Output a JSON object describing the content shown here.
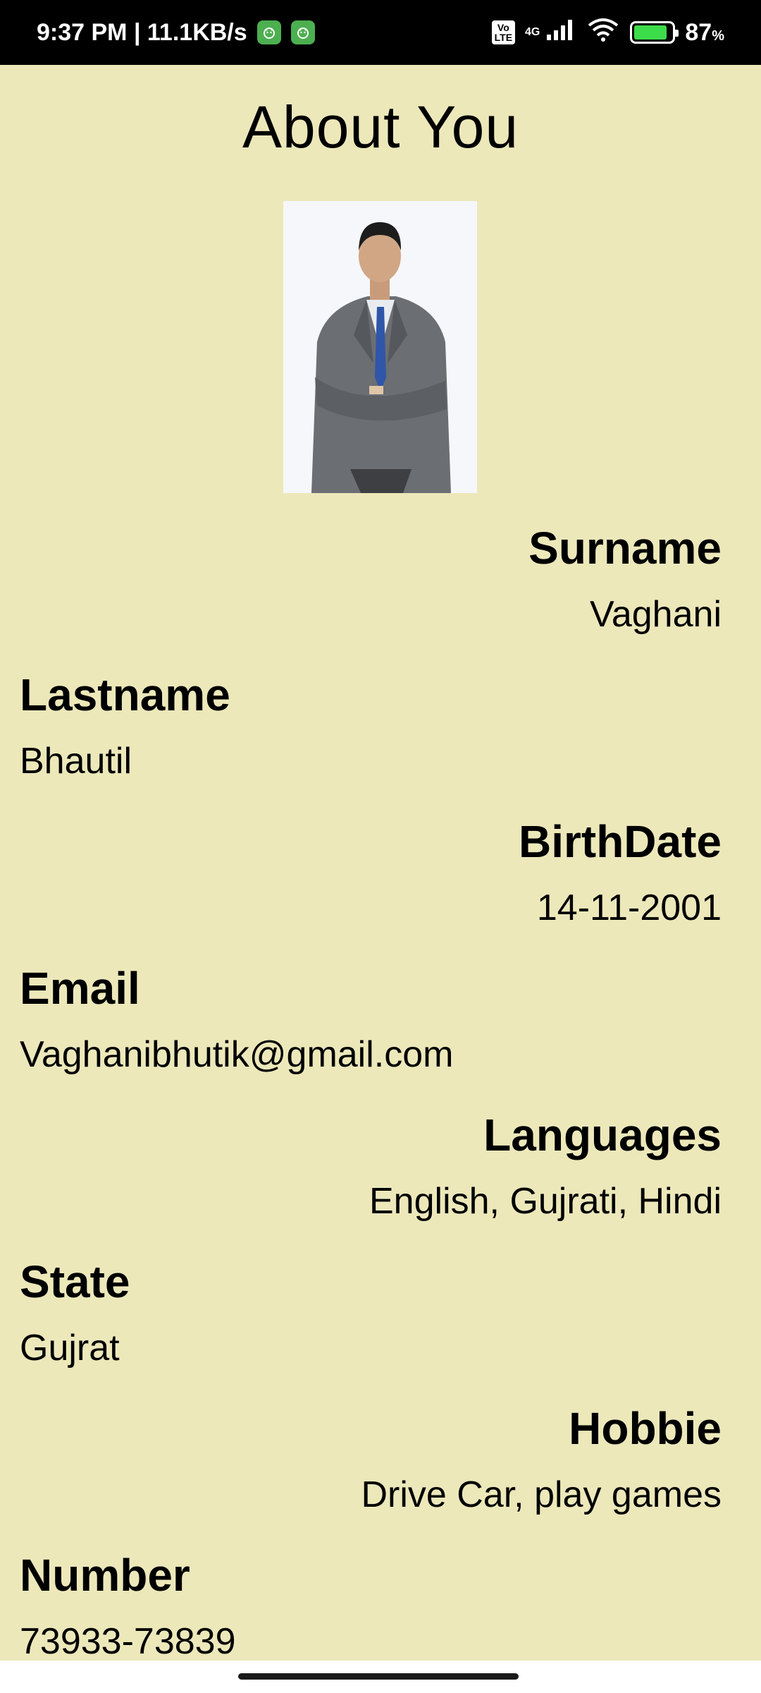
{
  "status_bar": {
    "time_speed": "9:37 PM | 11.1KB/s",
    "network_type": "4G",
    "volte_label_1": "Vo",
    "volte_label_2": "LTE",
    "battery_percent": "87",
    "battery_percent_sign": "%",
    "battery_level": 0.87,
    "battery_color": "#3DDC4A"
  },
  "page": {
    "title": "About You",
    "background_color": "#ECE8BA"
  },
  "fields": {
    "surname_label": "Surname",
    "surname_value": "Vaghani",
    "lastname_label": "Lastname",
    "lastname_value": "Bhautil",
    "birthdate_label": "BirthDate",
    "birthdate_value": "14-11-2001",
    "email_label": "Email",
    "email_value": "Vaghanibhutik@gmail.com",
    "languages_label": "Languages",
    "languages_value": "English, Gujrati, Hindi",
    "state_label": "State",
    "state_value": "Gujrat",
    "hobbie_label": "Hobbie",
    "hobbie_value": "Drive Car, play games",
    "number_label": "Number",
    "number_value": "73933-73839"
  }
}
